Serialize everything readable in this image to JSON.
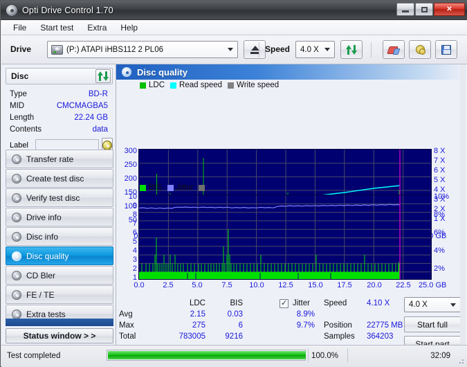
{
  "window": {
    "title": "Opti Drive Control 1.70",
    "icon": "disc-icon",
    "buttons": {
      "minimize": "–",
      "maximize": "□",
      "close": "✕"
    }
  },
  "menu": {
    "items": [
      "File",
      "Start test",
      "Extra",
      "Help"
    ]
  },
  "toolbar": {
    "drive_label": "Drive",
    "drive_value": "(P:)   ATAPI iHBS112   2 PL06",
    "eject_icon": "eject-icon",
    "speed_label": "Speed",
    "speed_value": "4.0 X",
    "refresh_icon": "refresh-icon",
    "erase_icon": "erase-icon",
    "settings_icon": "gear-icon",
    "save_icon": "save-icon"
  },
  "disc": {
    "header": "Disc",
    "refresh_icon": "refresh-icon",
    "rows": [
      {
        "key": "Type",
        "value": "BD-R"
      },
      {
        "key": "MID",
        "value": "CMCMAGBA5"
      },
      {
        "key": "Length",
        "value": "22.24 GB"
      },
      {
        "key": "Contents",
        "value": "data"
      }
    ],
    "label_key": "Label",
    "label_value": "",
    "label_placeholder": "",
    "label_button_icon": "cd-icon"
  },
  "sidebar": {
    "items": [
      {
        "label": "Transfer rate",
        "icon": "disc-icon",
        "active": false
      },
      {
        "label": "Create test disc",
        "icon": "disc-icon",
        "active": false
      },
      {
        "label": "Verify test disc",
        "icon": "disc-icon",
        "active": false
      },
      {
        "label": "Drive info",
        "icon": "disc-icon",
        "active": false
      },
      {
        "label": "Disc info",
        "icon": "disc-icon",
        "active": false
      },
      {
        "label": "Disc quality",
        "icon": "disc-icon",
        "active": true
      },
      {
        "label": "CD Bler",
        "icon": "disc-icon",
        "active": false
      },
      {
        "label": "FE / TE",
        "icon": "disc-icon",
        "active": false
      },
      {
        "label": "Extra tests",
        "icon": "disc-icon",
        "active": false
      }
    ],
    "status_window_button": "Status window > >"
  },
  "panel": {
    "title": "Disc quality",
    "icon": "disc-icon"
  },
  "colors": {
    "ldc": "#00c000",
    "bis": "#00e000",
    "read_speed": "#00ffff",
    "write_speed": "#808080",
    "jitter": "#8080ff",
    "plot_bg": "#000070",
    "grid": "#4a4a6a",
    "marker": "#c000c0",
    "accent": "#1818d8",
    "active_nav": "#0f9ae0"
  },
  "chart_data": [
    {
      "type": "line",
      "name": "disc-quality-ldc-chart",
      "title": "",
      "legend": [
        {
          "label": "LDC",
          "color": "#00c000"
        },
        {
          "label": "Read speed",
          "color": "#00ffff"
        },
        {
          "label": "Write speed",
          "color": "#808080"
        }
      ],
      "legend_position": "top-left",
      "grid": true,
      "xlabel": "GB",
      "ylabel": "LDC",
      "y2label": "X",
      "ylim": [
        0,
        300
      ],
      "y2lim": [
        0,
        8
      ],
      "xlim": [
        0,
        25
      ],
      "yticks": [
        50,
        100,
        150,
        200,
        250,
        300
      ],
      "y2ticks": [
        "1 X",
        "2 X",
        "3 X",
        "4 X",
        "5 X",
        "6 X",
        "7 X",
        "8 X"
      ],
      "xticks": [
        "0.0",
        "2.5",
        "5.0",
        "7.5",
        "10.0",
        "12.5",
        "15.0",
        "17.5",
        "20.0",
        "22.5",
        "25.0 GB"
      ],
      "data_end_gb": 22.24,
      "series": [
        {
          "name": "LDC",
          "color": "#00c000",
          "kind": "vertical-bars",
          "x": [
            0.0,
            0.3,
            0.6,
            0.9,
            1.2,
            1.45,
            1.7,
            2.0,
            2.3,
            2.55,
            2.8,
            3.1,
            3.4,
            3.7,
            4.0,
            4.3,
            4.6,
            4.9,
            5.2,
            5.45,
            5.7,
            6.0,
            6.3,
            6.6,
            6.9,
            7.2,
            7.5,
            7.8,
            8.1,
            8.4,
            8.7,
            9.0,
            9.3,
            9.6,
            9.9,
            10.2,
            10.5,
            10.8,
            11.1,
            11.4,
            11.7,
            12.0,
            12.3,
            12.6,
            12.9,
            13.2,
            13.5,
            13.8,
            14.1,
            14.4,
            14.7,
            15.0,
            15.3,
            15.6,
            15.9,
            16.2,
            16.5,
            16.8,
            17.1,
            17.4,
            17.7,
            18.0,
            18.3,
            18.6,
            18.9,
            19.2,
            19.5,
            19.8,
            20.1,
            20.4,
            20.7,
            21.0,
            21.3,
            21.6,
            21.9,
            22.2
          ],
          "y": [
            75,
            40,
            32,
            45,
            60,
            212,
            48,
            55,
            120,
            155,
            60,
            38,
            42,
            50,
            45,
            38,
            52,
            60,
            48,
            275,
            55,
            42,
            58,
            46,
            50,
            60,
            85,
            55,
            48,
            110,
            60,
            72,
            95,
            55,
            88,
            62,
            50,
            70,
            58,
            48,
            62,
            80,
            52,
            60,
            70,
            55,
            48,
            65,
            58,
            72,
            60,
            50,
            68,
            55,
            62,
            58,
            70,
            52,
            65,
            60,
            58,
            74,
            62,
            55,
            68,
            60,
            52,
            66,
            58,
            70,
            62,
            55,
            64,
            58,
            72,
            120
          ]
        },
        {
          "name": "Read speed",
          "color": "#00ffff",
          "kind": "line",
          "x": [
            0.0,
            2.5,
            5.0,
            7.5,
            10.0,
            12.5,
            15.0,
            17.5,
            20.0,
            22.24
          ],
          "y_x_units": [
            1.8,
            2.0,
            2.2,
            2.45,
            2.7,
            2.95,
            3.2,
            3.5,
            3.8,
            4.1
          ]
        },
        {
          "name": "Write speed",
          "color": "#808080",
          "kind": "line",
          "x": [],
          "y": []
        }
      ]
    },
    {
      "type": "line",
      "name": "disc-quality-bis-jitter-chart",
      "title": "",
      "legend": [
        {
          "label": "BIS",
          "color": "#00e000"
        },
        {
          "label": "Jitter",
          "color": "#8080ff"
        }
      ],
      "legend_position": "top-left",
      "grid": true,
      "xlabel": "GB",
      "ylabel": "BIS",
      "y2label": "%",
      "ylim": [
        0,
        10
      ],
      "y2lim": [
        0,
        10
      ],
      "xlim": [
        0,
        25
      ],
      "yticks": [
        1,
        2,
        3,
        4,
        5,
        6,
        7,
        8,
        9,
        10
      ],
      "y2ticks": [
        "2%",
        "4%",
        "6%",
        "8%",
        "10%"
      ],
      "xticks": [
        "0.0",
        "2.5",
        "5.0",
        "7.5",
        "10.0",
        "12.5",
        "15.0",
        "17.5",
        "20.0",
        "22.5",
        "25.0 GB"
      ],
      "data_end_gb": 22.24,
      "series": [
        {
          "name": "BIS",
          "color": "#00e000",
          "kind": "vertical-bars",
          "baseline": 1,
          "x": [
            0.2,
            0.5,
            0.8,
            1.1,
            1.35,
            1.45,
            1.6,
            1.85,
            2.1,
            2.35,
            2.6,
            2.85,
            3.1,
            3.4,
            3.7,
            4.0,
            4.3,
            4.6,
            4.9,
            5.15,
            5.3,
            5.4,
            5.6,
            5.9,
            6.2,
            6.5,
            6.8,
            7.1,
            7.4,
            7.55,
            7.8,
            8.1,
            8.4,
            8.7,
            9.0,
            9.3,
            9.6,
            9.9,
            10.2,
            10.5,
            10.8,
            11.1,
            11.3,
            11.6,
            11.9,
            12.2,
            12.5,
            12.8,
            13.1,
            13.4,
            13.7,
            14.0,
            14.3,
            14.6,
            14.9,
            15.2,
            15.5,
            15.8,
            16.1,
            16.4,
            16.7,
            17.0,
            17.3,
            17.6,
            17.9,
            18.2,
            18.5,
            18.8,
            19.1,
            19.4,
            19.7,
            20.0,
            20.3,
            20.6,
            20.9,
            21.2,
            21.5,
            21.8,
            22.1,
            22.2
          ],
          "y": [
            2,
            2,
            2,
            2,
            2,
            5,
            2,
            2,
            3,
            3,
            2,
            3,
            2,
            2,
            2,
            2,
            2,
            2,
            2,
            4,
            3,
            6,
            2,
            2,
            2,
            2,
            2,
            2,
            2,
            3,
            2,
            2,
            2,
            2,
            3,
            2,
            2,
            2,
            2,
            2,
            2,
            3,
            2,
            2,
            2,
            2,
            2,
            2,
            2,
            2,
            2,
            2,
            2,
            2,
            2,
            2,
            2,
            2,
            2,
            2,
            2,
            2,
            2,
            2,
            2,
            2,
            2,
            2,
            2,
            2,
            2,
            2,
            2,
            2,
            2,
            2,
            2,
            2,
            2,
            2
          ]
        },
        {
          "name": "Jitter",
          "color": "#8080ff",
          "kind": "line",
          "x": [
            0.0,
            0.5,
            1.0,
            1.5,
            2.0,
            2.5,
            2.9,
            3.5,
            4.0,
            4.5,
            5.0,
            5.5,
            6.0,
            6.5,
            7.0,
            7.4,
            7.8,
            8.5,
            9.2,
            10.0,
            11.0,
            12.0,
            13.0,
            14.0,
            15.0,
            16.0,
            17.0,
            18.0,
            19.0,
            20.0,
            21.0,
            22.0,
            22.24
          ],
          "y_pct": [
            8.5,
            8.5,
            8.5,
            8.5,
            8.5,
            8.6,
            8.8,
            8.8,
            8.8,
            8.8,
            8.85,
            8.8,
            8.8,
            8.7,
            8.6,
            8.65,
            9.0,
            9.0,
            9.05,
            9.1,
            9.1,
            9.2,
            9.15,
            9.2,
            9.25,
            9.3,
            9.35,
            9.3,
            9.4,
            9.3,
            9.4,
            9.35,
            9.3
          ]
        }
      ]
    }
  ],
  "stats": {
    "col_headers": [
      "LDC",
      "BIS",
      "Jitter"
    ],
    "jitter_checkbox_checked": true,
    "rows": [
      {
        "label": "Avg",
        "ldc": "2.15",
        "bis": "0.03",
        "jitter": "8.9%"
      },
      {
        "label": "Max",
        "ldc": "275",
        "bis": "6",
        "jitter": "9.7%"
      },
      {
        "label": "Total",
        "ldc": "783005",
        "bis": "9216",
        "jitter": ""
      }
    ],
    "info": [
      {
        "label": "Speed",
        "value": "4.10 X"
      },
      {
        "label": "Position",
        "value": "22775 MB"
      },
      {
        "label": "Samples",
        "value": "364203"
      }
    ],
    "speed_select": "4.0 X",
    "start_full_button": "Start full",
    "start_part_button": "Start part"
  },
  "statusbar": {
    "message": "Test completed",
    "progress_percent": 100.0,
    "progress_text": "100.0%",
    "elapsed": "32:09"
  }
}
